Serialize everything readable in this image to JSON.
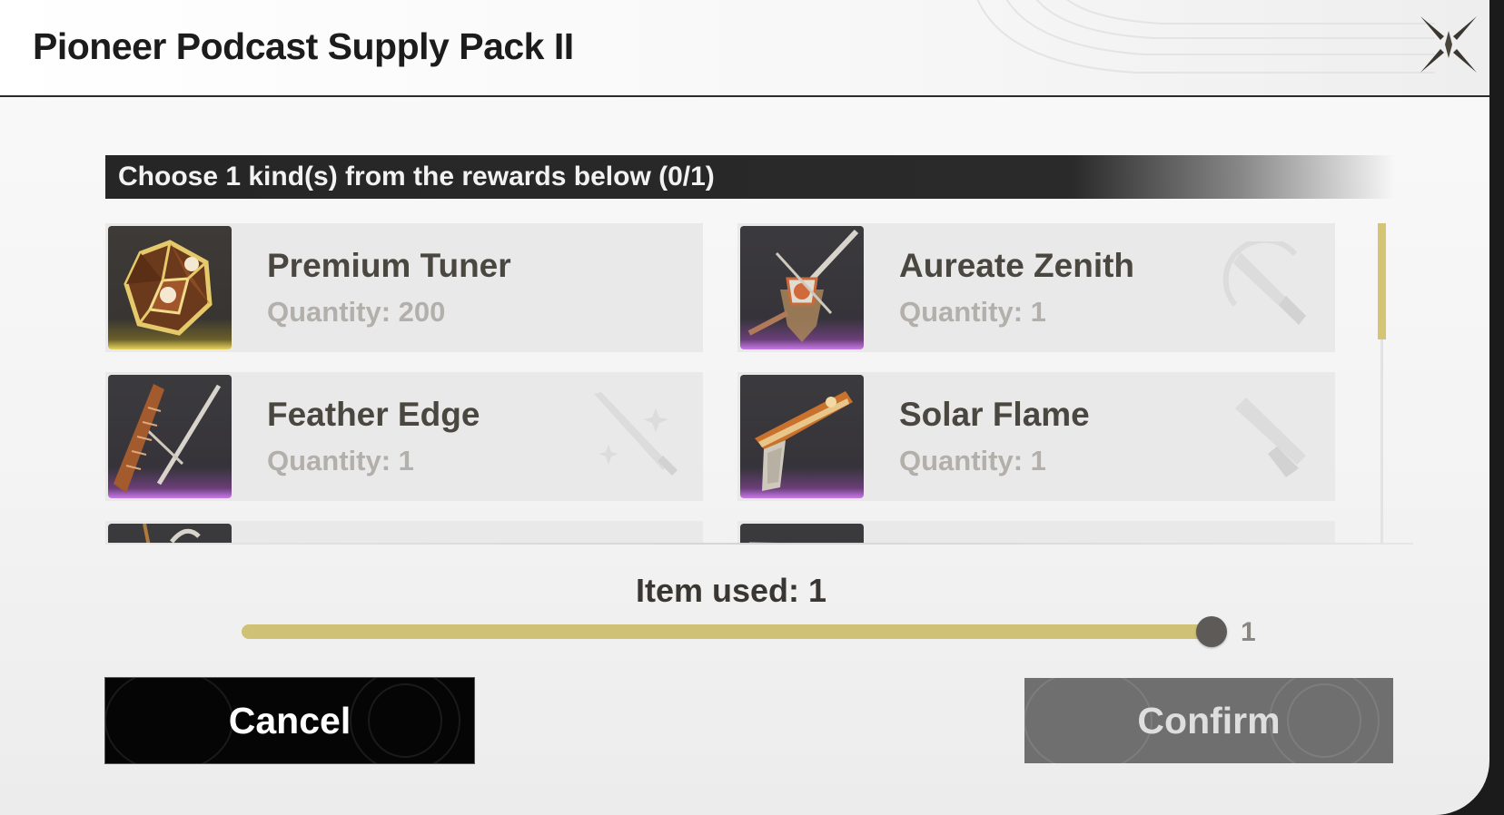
{
  "dialog": {
    "title": "Pioneer Podcast Supply Pack II",
    "instruction": "Choose 1 kind(s) from the rewards below (0/1)"
  },
  "rewards": [
    {
      "name": "Premium Tuner",
      "quantity": "Quantity: 200",
      "rarity": "gold",
      "icon": "tuner-item-icon",
      "type_icon": ""
    },
    {
      "name": "Aureate Zenith",
      "quantity": "Quantity: 1",
      "rarity": "purple",
      "icon": "broadblade-weapon-icon",
      "type_icon": "broadblade-type-icon"
    },
    {
      "name": "Feather Edge",
      "quantity": "Quantity: 1",
      "rarity": "purple",
      "icon": "sword-weapon-icon",
      "type_icon": "sword-type-icon"
    },
    {
      "name": "Solar Flame",
      "quantity": "Quantity: 1",
      "rarity": "purple",
      "icon": "pistol-weapon-icon",
      "type_icon": "pistol-type-icon"
    }
  ],
  "usage": {
    "label": "Item used: 1",
    "value": 1,
    "max_label": "1",
    "fill_fraction": 1.0
  },
  "buttons": {
    "cancel": "Cancel",
    "confirm": "Confirm"
  },
  "colors": {
    "gold_rarity": "#e8d35c",
    "purple_rarity": "#c879ea",
    "slider": "#cfc276",
    "accent_dark": "#262626"
  }
}
